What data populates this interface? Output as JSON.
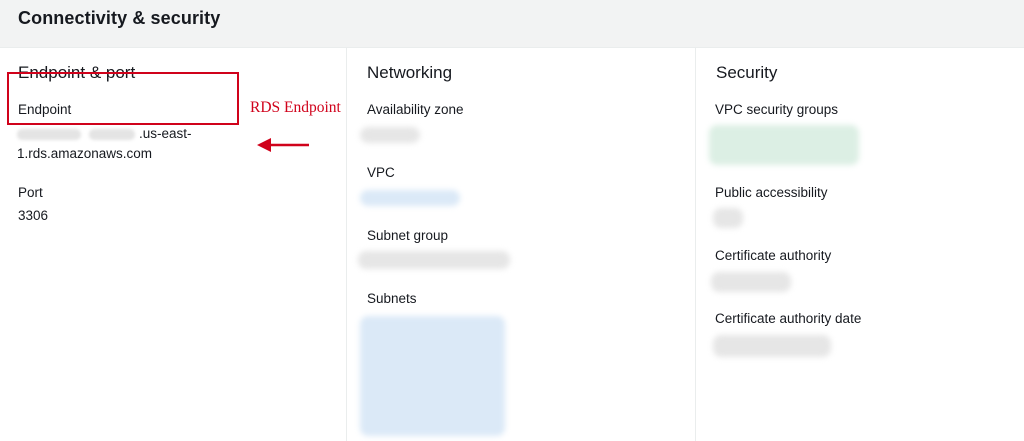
{
  "section_title": "Connectivity & security",
  "annotation_colors": {
    "accent": "#d0021b"
  },
  "endpoint_port": {
    "title": "Endpoint & port",
    "endpoint_label": "Endpoint",
    "endpoint_value_line1": ".us-east-",
    "endpoint_value_line2": "1.rds.amazonaws.com",
    "port_label": "Port",
    "port_value": "3306"
  },
  "annotation": {
    "text": "RDS Endpoint",
    "icon": "arrow-left-icon"
  },
  "networking": {
    "title": "Networking",
    "availability_zone_label": "Availability zone",
    "vpc_label": "VPC",
    "subnet_group_label": "Subnet group",
    "subnets_label": "Subnets"
  },
  "security": {
    "title": "Security",
    "vpc_security_groups_label": "VPC security groups",
    "public_accessibility_label": "Public accessibility",
    "certificate_authority_label": "Certificate authority",
    "certificate_authority_date_label": "Certificate authority date"
  }
}
